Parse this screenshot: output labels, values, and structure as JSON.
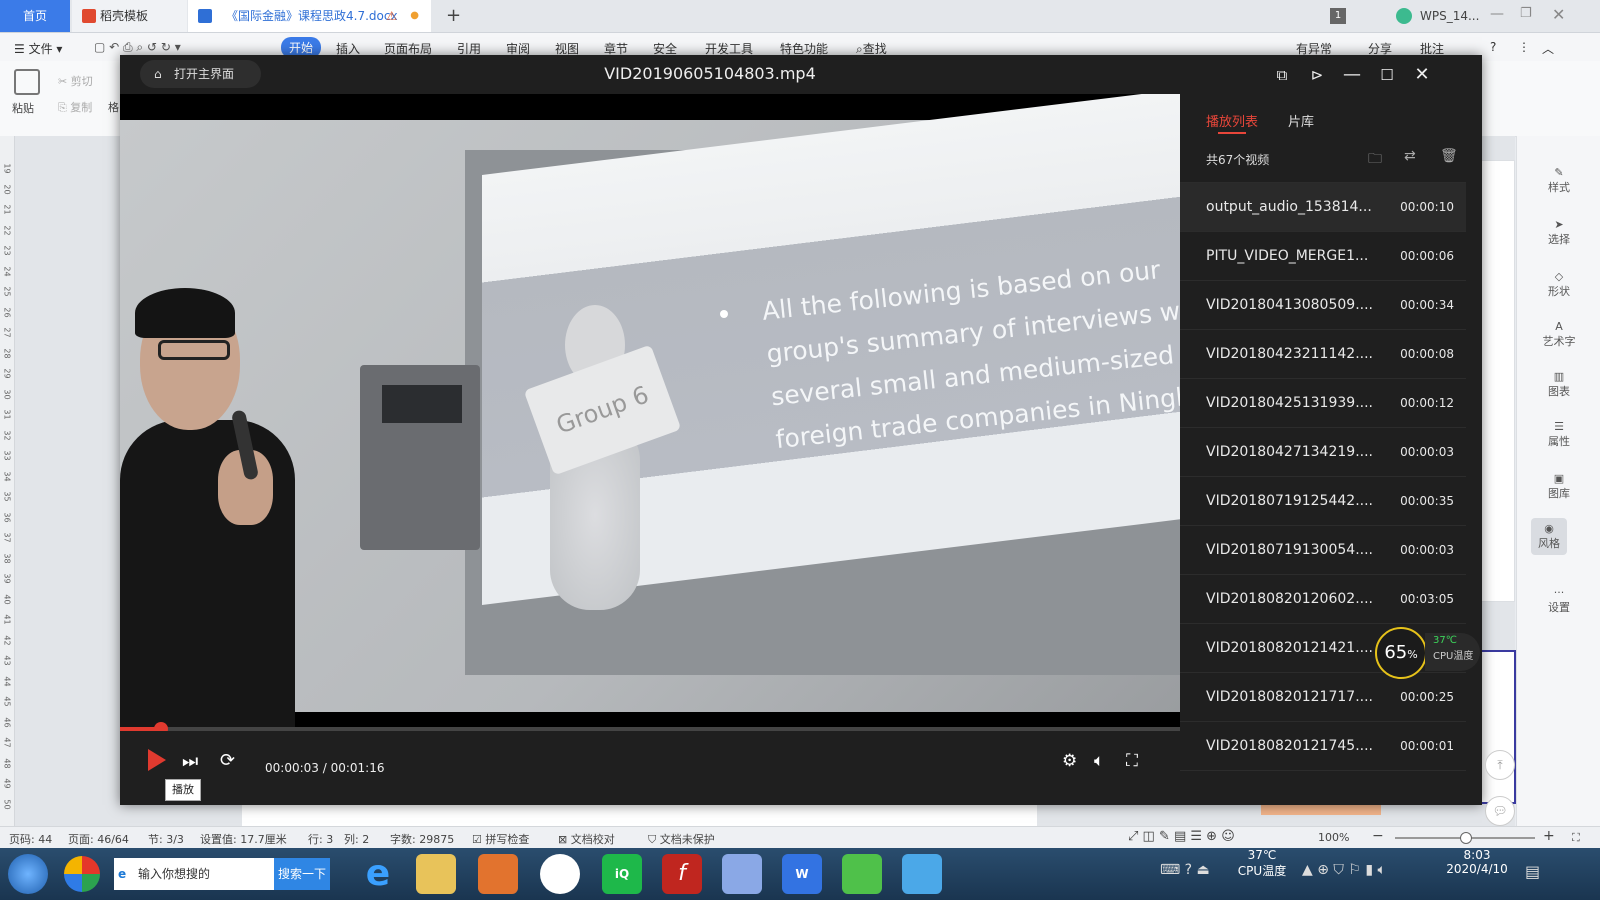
{
  "tabs": {
    "home": "首页",
    "daoke": "稻壳模板",
    "document": "《国际金融》课程思政4.7.docx",
    "new_tab": "+",
    "account": "WPS_14...",
    "window_count": "1"
  },
  "ribbon": {
    "file_menu": "文件",
    "menus": [
      "开始",
      "插入",
      "页面布局",
      "引用",
      "审阅",
      "视图",
      "章节",
      "安全",
      "开发工具",
      "特色功能"
    ],
    "search": "查找",
    "right_actions": [
      "有异常",
      "分享",
      "批注"
    ],
    "tools": {
      "paste": "粘贴",
      "cut": "剪切",
      "copy": "复制",
      "format": "格"
    }
  },
  "ruler_numbers": [
    "19",
    "20",
    "21",
    "22",
    "23",
    "24",
    "25",
    "26",
    "27",
    "28",
    "29",
    "30",
    "31",
    "32",
    "33",
    "34",
    "35",
    "36",
    "37",
    "38",
    "39",
    "40",
    "41",
    "42",
    "43",
    "44",
    "45",
    "46",
    "47",
    "48",
    "49",
    "50"
  ],
  "right_panel": [
    "样式",
    "选择",
    "形状",
    "艺术字",
    "图表",
    "属性",
    "图库",
    "风格",
    "设置"
  ],
  "player": {
    "home_button": "打开主界面",
    "title": "VID20190605104803.mp4",
    "time": "00:00:03 / 00:01:16",
    "play_tooltip": "播放",
    "progress_fraction": 0.039,
    "slide": {
      "sign_text": "Group 6",
      "lines": [
        "All the following is based on our",
        "group's summary of interviews wit",
        "several small and medium-sized",
        "foreign trade companies in Ningb"
      ]
    },
    "playlist": {
      "tab_list": "播放列表",
      "tab_library": "片库",
      "count_label": "共67个视频",
      "items": [
        {
          "name": "output_audio_153814...",
          "duration": "00:00:10"
        },
        {
          "name": "PITU_VIDEO_MERGE1...",
          "duration": "00:00:06"
        },
        {
          "name": "VID20180413080509....",
          "duration": "00:00:34"
        },
        {
          "name": "VID20180423211142....",
          "duration": "00:00:08"
        },
        {
          "name": "VID20180425131939....",
          "duration": "00:00:12"
        },
        {
          "name": "VID20180427134219....",
          "duration": "00:00:03"
        },
        {
          "name": "VID20180719125442....",
          "duration": "00:00:35"
        },
        {
          "name": "VID20180719130054....",
          "duration": "00:00:03"
        },
        {
          "name": "VID20180820120602....",
          "duration": "00:03:05"
        },
        {
          "name": "VID20180820121421....",
          "duration": ""
        },
        {
          "name": "VID20180820121717....",
          "duration": "00:00:25"
        },
        {
          "name": "VID20180820121745....",
          "duration": "00:00:01"
        }
      ]
    }
  },
  "cpu_widget": {
    "usage": "65",
    "unit": "%",
    "temp": "37℃",
    "label": "CPU温度"
  },
  "status_bar": {
    "page_no": "页码: 44",
    "pages": "页面: 46/64",
    "section": "节: 3/3",
    "setting": "设置值: 17.7厘米",
    "row": "行: 3",
    "col": "列: 2",
    "words": "字数: 29875",
    "spell": "拼写检查",
    "proof": "文档校对",
    "protect": "文档未保护",
    "zoom": "100%"
  },
  "taskbar": {
    "search_placeholder": "输入你想搜的",
    "search_button": "搜索一下",
    "cpu_temp": "37℃",
    "cpu_label": "CPU温度",
    "clock_time": "8:03",
    "clock_date": "2020/4/10"
  },
  "colors": {
    "accent_red": "#e03a2f",
    "wps_blue": "#3b7be8",
    "player_bg": "#1f1f1f"
  }
}
